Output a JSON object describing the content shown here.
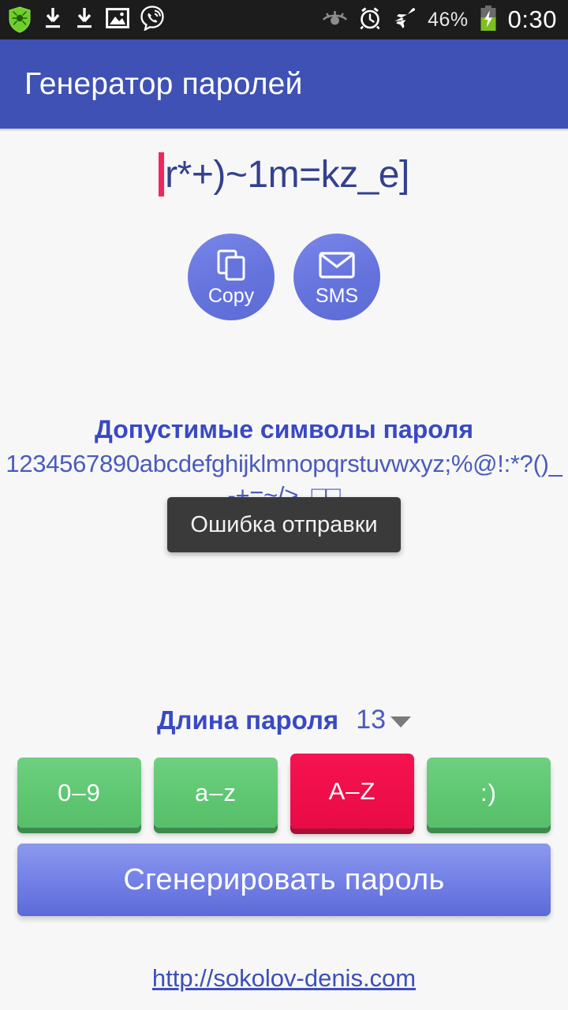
{
  "statusbar": {
    "left_icons": [
      {
        "name": "drweb-shield-icon",
        "label": "Dr.Web"
      },
      {
        "name": "download-icon",
        "label": "Download"
      },
      {
        "name": "download-icon-2",
        "label": "Download"
      },
      {
        "name": "image-icon",
        "label": "Image"
      },
      {
        "name": "viber-icon",
        "label": "Viber"
      }
    ],
    "right_icons": [
      {
        "name": "eye-icon",
        "label": "Eye"
      },
      {
        "name": "alarm-clock-icon",
        "label": "Alarm"
      },
      {
        "name": "airplane-mode-icon",
        "label": "Airplane mode"
      },
      {
        "name": "battery-charging-icon",
        "label": "Battery charging"
      }
    ],
    "battery_percent": "46%",
    "clock": "0:30",
    "background": "#1c1c1c"
  },
  "appbar": {
    "title": "Генератор паролей",
    "background": "#3f51b5",
    "text_color": "#ffffff"
  },
  "password": {
    "value": "r*+)~1m=kz_e]",
    "caret_color": "#f0275e",
    "text_color": "#33418f"
  },
  "actions": [
    {
      "name": "copy-button",
      "label": "Copy",
      "icon": "copy-icon"
    },
    {
      "name": "sms-button",
      "label": "SMS",
      "icon": "envelope-icon"
    }
  ],
  "charset": {
    "heading": "Допустимые символы пароля",
    "characters": "1234567890abcdefghijklmnopqrstuvwxyz;%@!:*?()_-+=~/>,.□□",
    "heading_color": "#3949c4",
    "text_color": "#4a5bbd"
  },
  "toast": {
    "message": "Ошибка отправки",
    "background": "#3a3a3a",
    "text_color": "#f2f2f2"
  },
  "length": {
    "label": "Длина пароля",
    "value": "13"
  },
  "toggles": [
    {
      "name": "toggle-digits",
      "label": "0–9",
      "state": "on",
      "color": "#5ec671"
    },
    {
      "name": "toggle-lowercase",
      "label": "a–z",
      "state": "on",
      "color": "#5ec671"
    },
    {
      "name": "toggle-uppercase",
      "label": "A–Z",
      "state": "off",
      "color": "#f51350"
    },
    {
      "name": "toggle-symbols",
      "label": ":)",
      "state": "on",
      "color": "#5ec671"
    }
  ],
  "generate": {
    "label": "Сгенерировать пароль",
    "color": "#6573dd"
  },
  "footer": {
    "link_text": "http://sokolov-denis.com",
    "link_color": "#3d4fb8"
  }
}
